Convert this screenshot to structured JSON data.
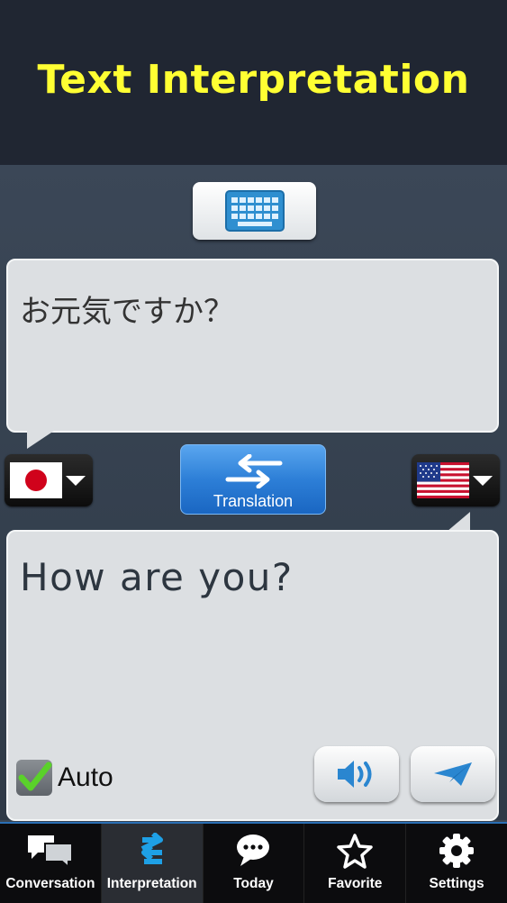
{
  "header": {
    "title": "Text Interpretation"
  },
  "keyboard_button": {
    "icon": "keyboard-icon"
  },
  "source": {
    "text": "お元気ですか？",
    "language_flag": "japan-flag-icon"
  },
  "target": {
    "text": "How are you?",
    "language_flag": "us-flag-icon"
  },
  "translate_button": {
    "label": "Translation",
    "icon": "swap-arrows-icon"
  },
  "auto": {
    "label": "Auto",
    "checked": true
  },
  "actions": {
    "speak_icon": "speaker-icon",
    "send_icon": "send-icon"
  },
  "tabs": [
    {
      "label": "Conversation",
      "icon": "chat-bubbles-icon",
      "active": false
    },
    {
      "label": "Interpretation",
      "icon": "swap-arrows-icon",
      "active": true
    },
    {
      "label": "Today",
      "icon": "speech-bubble-icon",
      "active": false
    },
    {
      "label": "Favorite",
      "icon": "star-icon",
      "active": false
    },
    {
      "label": "Settings",
      "icon": "gear-icon",
      "active": false
    }
  ],
  "colors": {
    "header_text": "#ffff33",
    "accent": "#2d7fd7",
    "header_bg": "#202632"
  }
}
